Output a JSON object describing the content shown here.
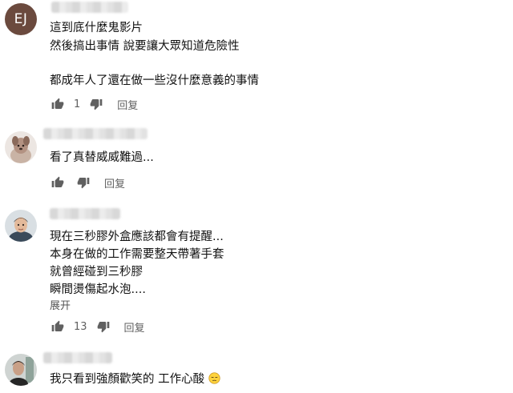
{
  "comments": [
    {
      "avatar_initials": "EJ",
      "lines": [
        "這到底什麼鬼影片",
        "然後搞出事情 說要讓大眾知道危險性",
        "",
        "都成年人了還在做一些沒什麼意義的事情"
      ],
      "likes": "1",
      "reply_label": "回复"
    },
    {
      "lines": [
        "看了真替威威難過..."
      ],
      "likes": "",
      "reply_label": "回复"
    },
    {
      "lines": [
        "現在三秒膠外盒應該都會有提醒...",
        "本身在做的工作需要整天帶著手套",
        "就曾經碰到三秒膠",
        "瞬間燙傷起水泡...."
      ],
      "expand_label": "展开",
      "likes": "13",
      "reply_label": "回复"
    },
    {
      "lines": [
        "我只看到強顏歡笑的 工作心酸"
      ],
      "emoji": "pensive-face"
    }
  ],
  "colors": {
    "icon": "#606060",
    "text": "#0f0f0f",
    "avatar_ej_bg": "#6b4a3e"
  }
}
